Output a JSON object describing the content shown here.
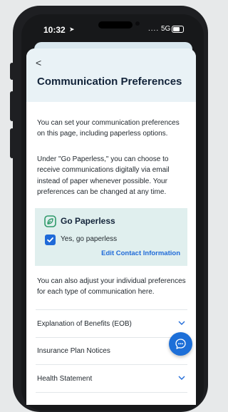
{
  "status_bar": {
    "time": "10:32",
    "signal": "....",
    "network": "5G"
  },
  "header": {
    "back_label": "<",
    "title": "Communication Preferences"
  },
  "intro_paragraph": "You can set your communication preferences on this page, including paperless options.",
  "paperless_paragraph": "Under \"Go Paperless,\" you can choose to receive communications digitally via email instead of paper whenever possible. Your preferences can be changed at any time.",
  "paperless_card": {
    "title": "Go Paperless",
    "checkbox_label": "Yes, go paperless",
    "checked": true,
    "edit_link": "Edit Contact Information",
    "background_color": "#e0efee"
  },
  "adjust_paragraph": "You can also adjust your individual preferences for each type of communication here.",
  "preferences": [
    {
      "label": "Explanation of Benefits (EOB)"
    },
    {
      "label": "Insurance Plan Notices"
    },
    {
      "label": "Health Statement"
    }
  ],
  "accent_color": "#1f6ad8",
  "chat_button_icon": "chat-bubble-icon"
}
